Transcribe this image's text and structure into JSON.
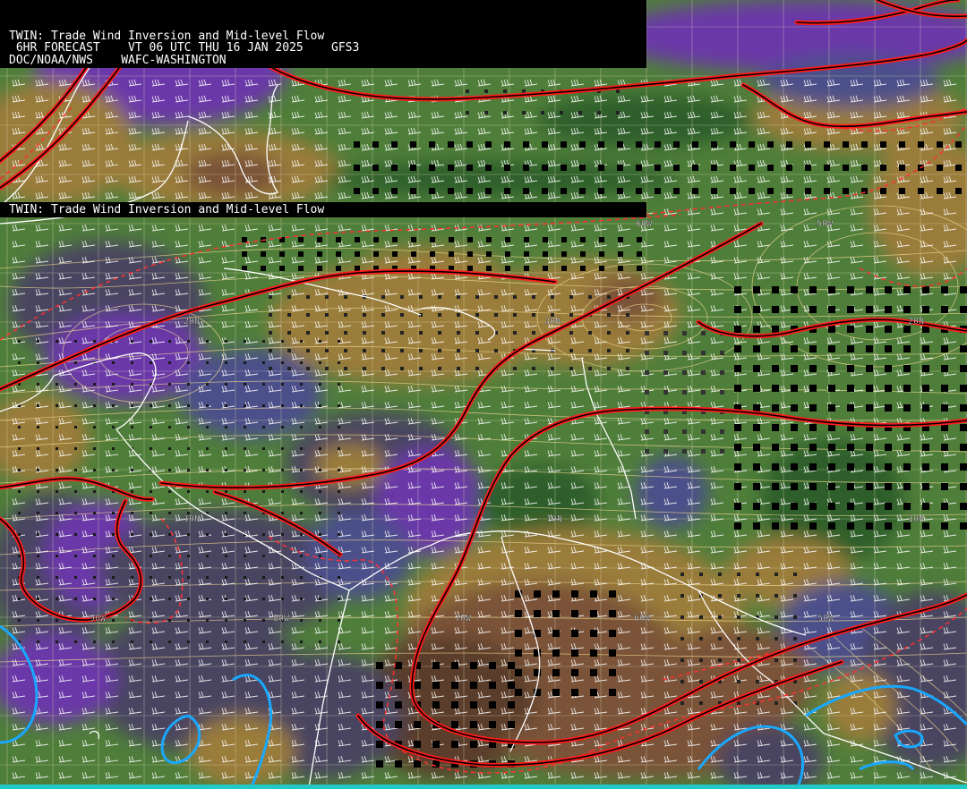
{
  "header": {
    "line1": "TWIN: Trade Wind Inversion and Mid-level Flow",
    "line2": " 6HR FORECAST    VT 06 UTC THU 16 JAN 2025    GFS3",
    "line3": "DOC/NOAA/NWS    WAFC-WASHINGTON"
  },
  "banner": {
    "title": "TWIN: Trade Wind Inversion and Mid-level Flow"
  },
  "map": {
    "longitude_labels": [
      "90W",
      "80W",
      "70W",
      "60W",
      "50W"
    ],
    "latitude_labels": [
      "20N",
      "20N",
      "10N",
      "10N"
    ],
    "interior_labels": [
      "60W",
      "50W",
      "10N",
      "20N"
    ],
    "colors": {
      "background_green": "#4f7e3a",
      "dark_green": "#2e5e2a",
      "tan": "#9a7b3a",
      "brown": "#7a5238",
      "dark_brown": "#5a3c2c",
      "slate": "#4a4560",
      "purple": "#6a38a8",
      "violet": "#7b45c8",
      "blue_gray": "#4b4f8a",
      "inversion_line_red": "#ff1a1a",
      "inversion_line_core": "#000000",
      "dashed_red": "#ff3030",
      "streamline": "#f0d890",
      "coastline": "#ffffff",
      "grid": "#e8e0c0",
      "cyan_contour": "#19a8ff",
      "bottom_strip": "#21c9c9"
    }
  }
}
